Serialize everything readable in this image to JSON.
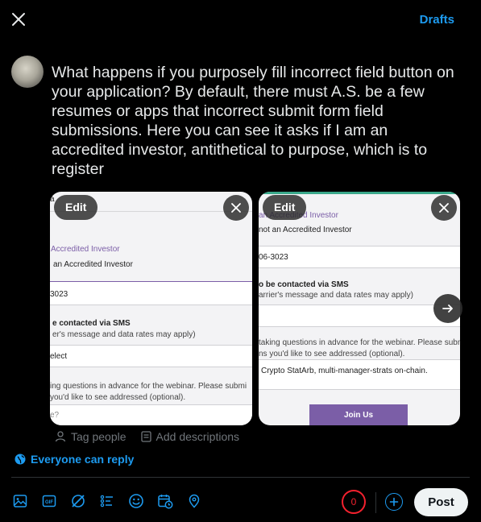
{
  "header": {
    "drafts_label": "Drafts"
  },
  "tweet": {
    "text": "What happens if you purposely fill incorrect field button on your application? By default, there must A.S. be a few resumes or apps that incorrect submit form field submissions. Here you can see it asks if I am an accredited investor, antithetical to purpose, which is to register"
  },
  "media": [
    {
      "edit_label": "Edit",
      "form": {
        "top_fragment": "a",
        "investor_label": "Accredited Investor",
        "investor_value": "an Accredited Investor",
        "phone_value": "3023",
        "sms_label": "e contacted via SMS",
        "sms_note": "er's message and data rates may apply)",
        "select_value": "elect",
        "questions_label_1": "ing questions in advance for the webinar. Please submi",
        "questions_label_2": "you'd like to see addressed (optional).",
        "textarea_value": "e?"
      }
    },
    {
      "edit_label": "Edit",
      "form": {
        "investor_label": "an Accredited Investor",
        "investor_value": "not an Accredited Investor",
        "phone_value": "06-3023",
        "sms_label": "o be contacted via SMS",
        "sms_note": "arrier's message and data rates may apply)",
        "questions_label_1": "taking questions in advance for the webinar. Please submi",
        "questions_label_2": "ns you'd like to see addressed (optional).",
        "textarea_value": "Crypto StatArb, multi-manager-strats on-chain.",
        "join_button": "Join Us"
      }
    }
  ],
  "media_meta": {
    "tag_people": "Tag people",
    "add_descriptions": "Add descriptions"
  },
  "reply_setting": {
    "label": "Everyone can reply"
  },
  "composer": {
    "char_counter": "0",
    "post_label": "Post"
  },
  "colors": {
    "accent": "#1d9bf0",
    "danger": "#f4212e",
    "form_purple": "#7b5ea7"
  }
}
